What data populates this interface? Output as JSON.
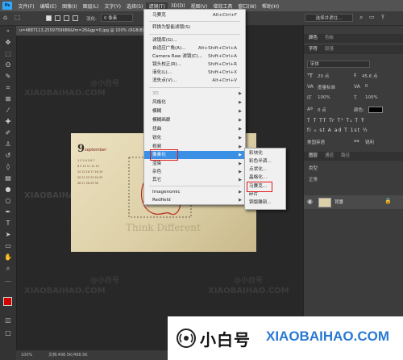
{
  "app": {
    "logo": "Ps"
  },
  "menubar": [
    "文件(F)",
    "编辑(E)",
    "图像(I)",
    "图层(L)",
    "文字(Y)",
    "选择(S)",
    "滤镜(T)",
    "3D(D)",
    "视图(V)",
    "增效工具",
    "窗口(W)",
    "帮助(H)"
  ],
  "optionsbar": {
    "feather_label": "羽化:",
    "feather_value": "0 像素",
    "select_mask_button": "选择并遮住..."
  },
  "document_tab": {
    "title": "u=4887113,2559759686&fm=26&gp=0.jpg @ 100% (RGB/8)"
  },
  "filter_menu": {
    "items": [
      {
        "label": "马赛克",
        "shortcut": "Alt+Ctrl+F"
      },
      {
        "label": "转换为智能滤镜(S)",
        "shortcut": ""
      },
      {
        "label": "滤镜库(G)...",
        "shortcut": ""
      },
      {
        "label": "自适应广角(A)...",
        "shortcut": "Alt+Shift+Ctrl+A"
      },
      {
        "label": "Camera Raw 滤镜(C)...",
        "shortcut": "Shift+Ctrl+A"
      },
      {
        "label": "镜头校正(R)...",
        "shortcut": "Shift+Ctrl+R"
      },
      {
        "label": "液化(L)...",
        "shortcut": "Shift+Ctrl+X"
      },
      {
        "label": "消失点(V)...",
        "shortcut": "Alt+Ctrl+V"
      },
      {
        "label": "3D",
        "shortcut": ""
      },
      {
        "label": "风格化",
        "shortcut": ""
      },
      {
        "label": "模糊",
        "shortcut": ""
      },
      {
        "label": "模糊画廊",
        "shortcut": ""
      },
      {
        "label": "扭曲",
        "shortcut": ""
      },
      {
        "label": "锐化",
        "shortcut": ""
      },
      {
        "label": "视频",
        "shortcut": ""
      },
      {
        "label": "像素化",
        "shortcut": ""
      },
      {
        "label": "渲染",
        "shortcut": ""
      },
      {
        "label": "杂色",
        "shortcut": ""
      },
      {
        "label": "其它",
        "shortcut": ""
      },
      {
        "label": "Imagenomic",
        "shortcut": ""
      },
      {
        "label": "Redfield",
        "shortcut": ""
      }
    ]
  },
  "pixelate_submenu": [
    "彩块化",
    "彩色半调...",
    "点状化...",
    "晶格化...",
    "马赛克...",
    "碎片",
    "铜版雕刻..."
  ],
  "panels": {
    "top_tabs": [
      "颜色",
      "色板"
    ],
    "char_tabs": [
      "字符",
      "段落"
    ],
    "font": "宋体",
    "font_size": "20 点",
    "leading": "45.6 点",
    "tracking": "度量标准",
    "kerning": "0",
    "scale_v": "100%",
    "scale_h": "100%",
    "baseline": "0 点",
    "color_label": "颜色:",
    "aa_label": "aa",
    "aa_value": "锐利",
    "layer_tabs": [
      "图层",
      "通道",
      "路径"
    ],
    "kind_label": "类型",
    "blend_mode": "正常",
    "layer_name": "背景"
  },
  "canvas": {
    "date_number": "9",
    "month": "september",
    "slogan": "Think Different"
  },
  "status": {
    "zoom": "100%",
    "doc_info": "文档:498.5K/498.5K"
  },
  "watermark": {
    "cn": "@小白号",
    "en": "XIAOBAIHAO.COM"
  },
  "banner": {
    "cn": "小白号",
    "en": "XIAOBAIHAO.COM"
  },
  "colors": {
    "highlight": "#3b8fe5",
    "annotation_red": "#e01818",
    "brand_blue": "#2a79d4"
  }
}
